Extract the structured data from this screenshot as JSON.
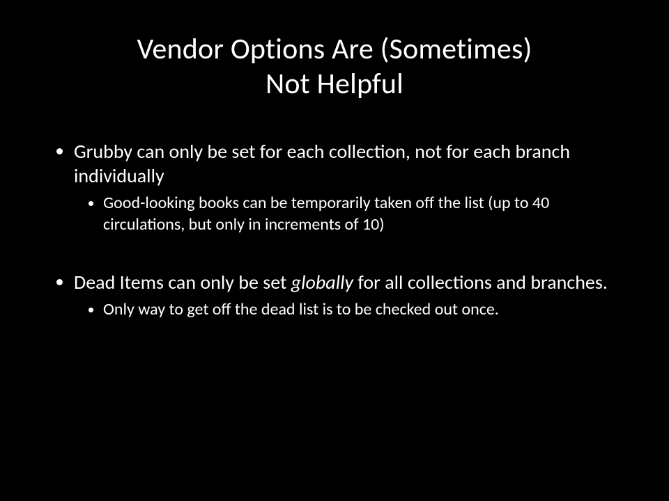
{
  "title_line1": "Vendor Options Are (Sometimes)",
  "title_line2": "Not Helpful",
  "bullets": {
    "b1": "Grubby can only be set for each collection, not for each branch individually",
    "b1_sub1": "Good-looking books can be temporarily taken off the list (up to 40 circulations, but only in increments of 10)",
    "b2_pre": "Dead Items can only be set ",
    "b2_em": "globally",
    "b2_post": " for all collections and branches.",
    "b2_sub1": "Only way to get off the dead list is to be checked out once."
  }
}
